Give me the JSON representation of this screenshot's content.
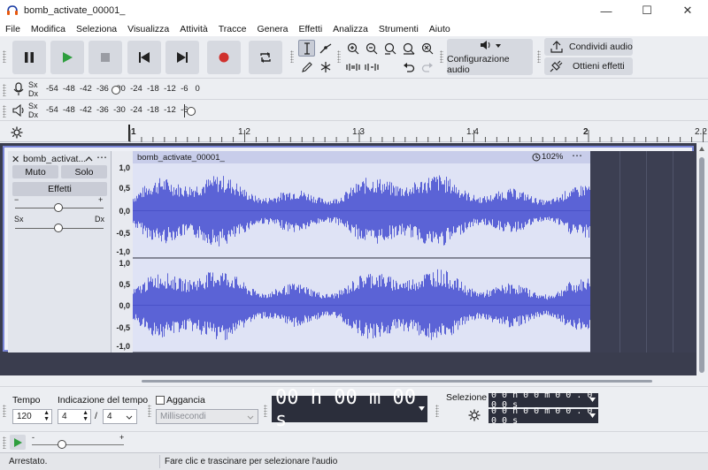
{
  "window": {
    "title": "bomb_activate_00001_",
    "minimize": "—",
    "maximize": "☐",
    "close": "✕"
  },
  "menu": [
    "File",
    "Modifica",
    "Seleziona",
    "Visualizza",
    "Attività",
    "Tracce",
    "Genera",
    "Effetti",
    "Analizza",
    "Strumenti",
    "Aiuto"
  ],
  "toolbar": {
    "audio_setup_label": "Configurazione audio",
    "share_audio_label": "Condividi audio",
    "get_effects_label": "Ottieni effetti"
  },
  "meters": {
    "record": {
      "lr": [
        "Sx",
        "Dx"
      ],
      "scale": [
        "-54",
        "-48",
        "-42",
        "-36",
        "-30",
        "-24",
        "-18",
        "-12",
        "-6",
        "0"
      ]
    },
    "play": {
      "lr": [
        "Sx",
        "Dx"
      ],
      "scale": [
        "-54",
        "-48",
        "-42",
        "-36",
        "-30",
        "-24",
        "-18",
        "-12",
        "-6",
        ""
      ]
    }
  },
  "ruler": {
    "labels": [
      "1",
      "1.2",
      "1.3",
      "1.4",
      "2",
      "2.2"
    ]
  },
  "track": {
    "name": "bomb_activat...",
    "mute_label": "Muto",
    "solo_label": "Solo",
    "effects_label": "Effetti",
    "gain_minus": "−",
    "gain_plus": "+",
    "pan_left": "Sx",
    "pan_right": "Dx",
    "clip_name": "bomb_activate_00001_",
    "clip_speed": "102%",
    "scale_labels": [
      "1,0",
      "0,5",
      "0,0",
      "-0,5",
      "-1,0"
    ]
  },
  "bottom": {
    "tempo_label": "Tempo",
    "tempo_value": "120",
    "time_sig_label": "Indicazione del tempo",
    "time_sig_num": "4",
    "time_sig_sep": "/",
    "time_sig_den": "4",
    "snap_label": "Aggancia",
    "snap_unit": "Millisecondi",
    "time_display": "00 h 00 m 00 s",
    "selection_label": "Selezione",
    "selection_start": "0 0 h 0 0 m 0 0 . 0 0 0 s",
    "selection_end": "0 0 h 0 0 m 0 0 . 0 0 0 s"
  },
  "status": {
    "left": "Arrestato.",
    "right": "Fare clic e trascinare per selezionare l'audio"
  },
  "colors": {
    "waveform": "#5b63d6",
    "clip_bg": "#dfe3f5",
    "clip_header": "#c8cdea",
    "track_bg": "#3c3f52",
    "record": "#d0312d",
    "play": "#2e9e3e"
  }
}
